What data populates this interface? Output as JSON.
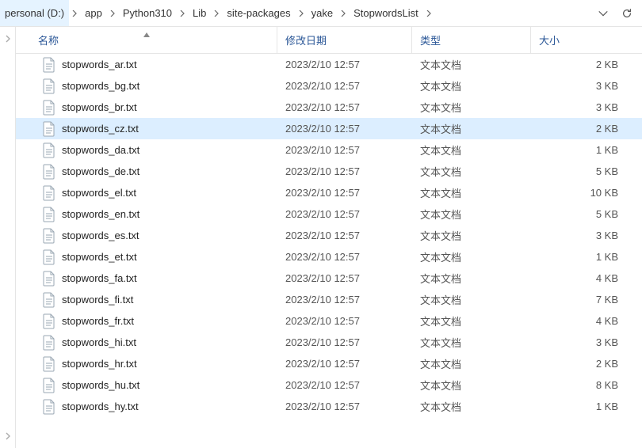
{
  "breadcrumb": [
    "personal (D:)",
    "app",
    "Python310",
    "Lib",
    "site-packages",
    "yake",
    "StopwordsList"
  ],
  "headers": {
    "name": "名称",
    "date": "修改日期",
    "type": "类型",
    "size": "大小"
  },
  "selected_index": 3,
  "files": [
    {
      "name": "stopwords_ar.txt",
      "date": "2023/2/10 12:57",
      "type": "文本文档",
      "size": "2 KB"
    },
    {
      "name": "stopwords_bg.txt",
      "date": "2023/2/10 12:57",
      "type": "文本文档",
      "size": "3 KB"
    },
    {
      "name": "stopwords_br.txt",
      "date": "2023/2/10 12:57",
      "type": "文本文档",
      "size": "3 KB"
    },
    {
      "name": "stopwords_cz.txt",
      "date": "2023/2/10 12:57",
      "type": "文本文档",
      "size": "2 KB"
    },
    {
      "name": "stopwords_da.txt",
      "date": "2023/2/10 12:57",
      "type": "文本文档",
      "size": "1 KB"
    },
    {
      "name": "stopwords_de.txt",
      "date": "2023/2/10 12:57",
      "type": "文本文档",
      "size": "5 KB"
    },
    {
      "name": "stopwords_el.txt",
      "date": "2023/2/10 12:57",
      "type": "文本文档",
      "size": "10 KB"
    },
    {
      "name": "stopwords_en.txt",
      "date": "2023/2/10 12:57",
      "type": "文本文档",
      "size": "5 KB"
    },
    {
      "name": "stopwords_es.txt",
      "date": "2023/2/10 12:57",
      "type": "文本文档",
      "size": "3 KB"
    },
    {
      "name": "stopwords_et.txt",
      "date": "2023/2/10 12:57",
      "type": "文本文档",
      "size": "1 KB"
    },
    {
      "name": "stopwords_fa.txt",
      "date": "2023/2/10 12:57",
      "type": "文本文档",
      "size": "4 KB"
    },
    {
      "name": "stopwords_fi.txt",
      "date": "2023/2/10 12:57",
      "type": "文本文档",
      "size": "7 KB"
    },
    {
      "name": "stopwords_fr.txt",
      "date": "2023/2/10 12:57",
      "type": "文本文档",
      "size": "4 KB"
    },
    {
      "name": "stopwords_hi.txt",
      "date": "2023/2/10 12:57",
      "type": "文本文档",
      "size": "3 KB"
    },
    {
      "name": "stopwords_hr.txt",
      "date": "2023/2/10 12:57",
      "type": "文本文档",
      "size": "2 KB"
    },
    {
      "name": "stopwords_hu.txt",
      "date": "2023/2/10 12:57",
      "type": "文本文档",
      "size": "8 KB"
    },
    {
      "name": "stopwords_hy.txt",
      "date": "2023/2/10 12:57",
      "type": "文本文档",
      "size": "1 KB"
    }
  ]
}
